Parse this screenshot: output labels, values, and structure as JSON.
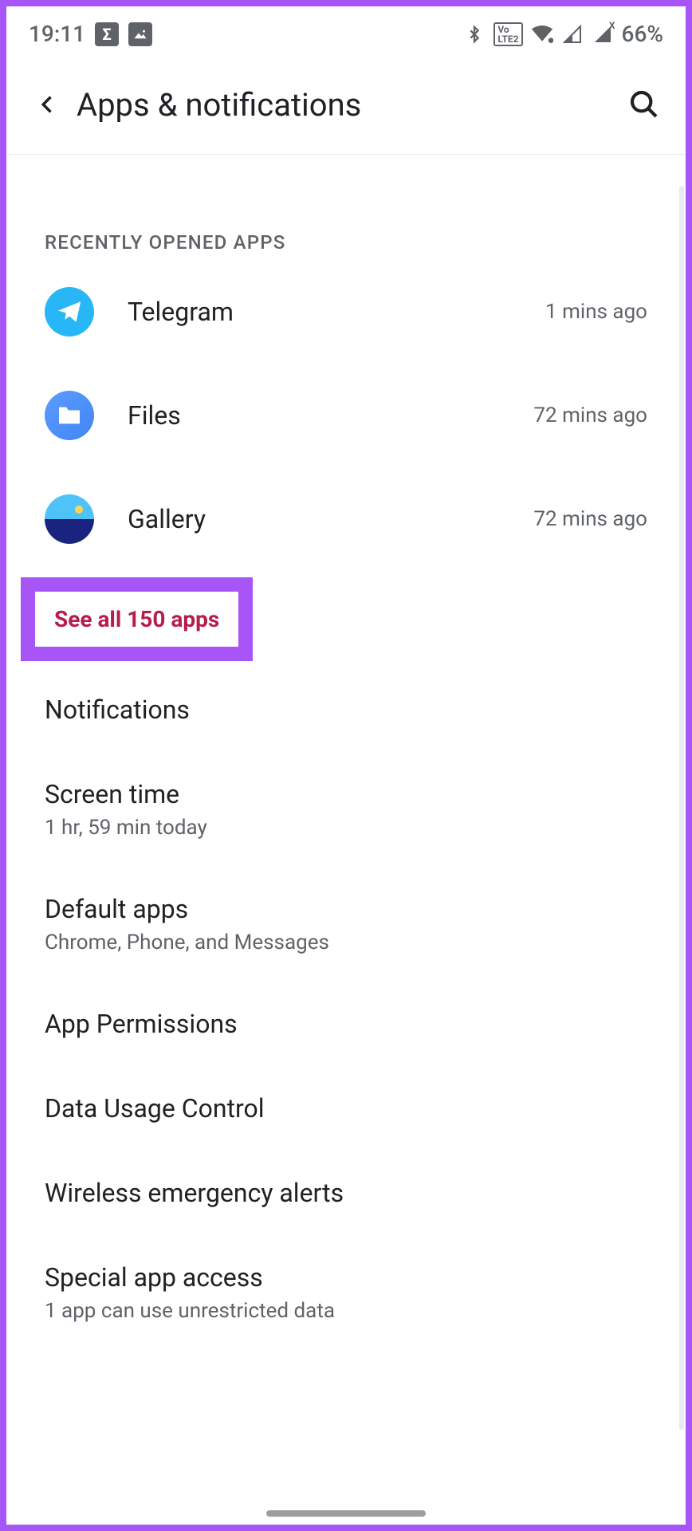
{
  "status": {
    "time": "19:11",
    "battery": "66%"
  },
  "header": {
    "title": "Apps & notifications"
  },
  "recent": {
    "section_label": "RECENTLY OPENED APPS",
    "apps": [
      {
        "name": "Telegram",
        "time": "1 mins ago"
      },
      {
        "name": "Files",
        "time": "72 mins ago"
      },
      {
        "name": "Gallery",
        "time": "72 mins ago"
      }
    ],
    "see_all": "See all 150 apps"
  },
  "settings": [
    {
      "title": "Notifications",
      "sub": ""
    },
    {
      "title": "Screen time",
      "sub": "1 hr, 59 min today"
    },
    {
      "title": "Default apps",
      "sub": "Chrome, Phone, and Messages"
    },
    {
      "title": "App Permissions",
      "sub": ""
    },
    {
      "title": "Data Usage Control",
      "sub": ""
    },
    {
      "title": "Wireless emergency alerts",
      "sub": ""
    },
    {
      "title": "Special app access",
      "sub": "1 app can use unrestricted data"
    }
  ]
}
